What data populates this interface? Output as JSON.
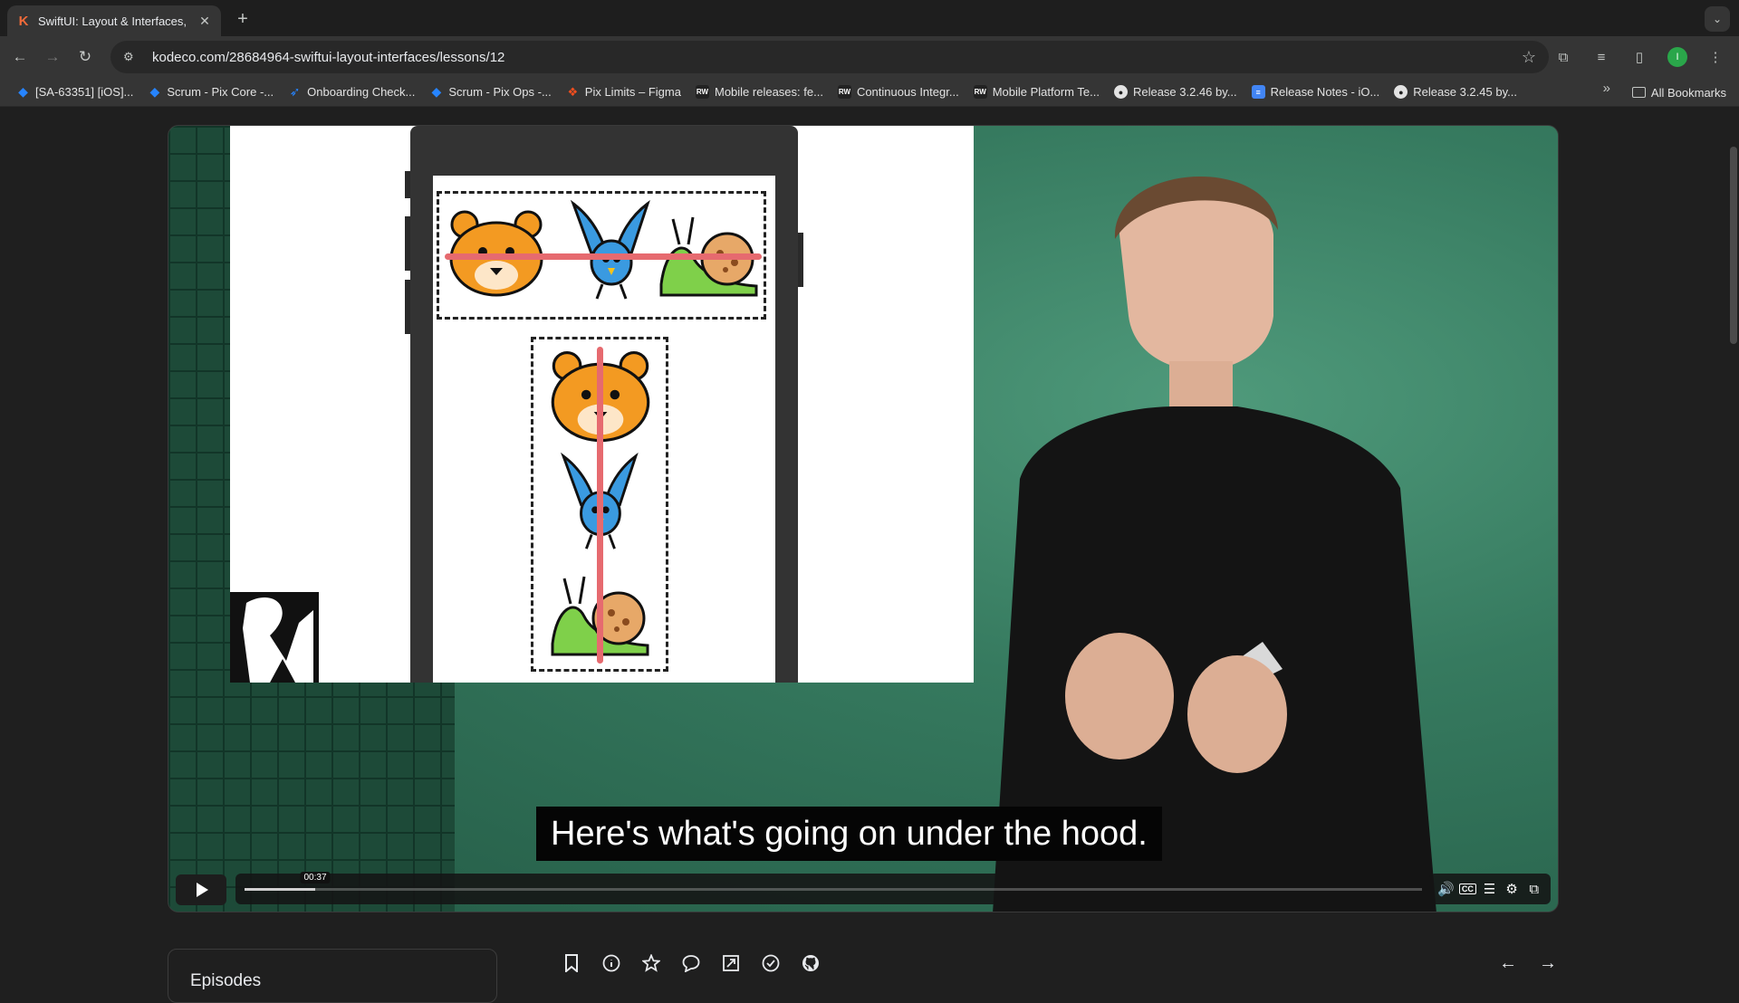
{
  "browser": {
    "tab": {
      "title": "SwiftUI: Layout & Interfaces, l",
      "favicon": "K"
    },
    "url": "kodeco.com/28684964-swiftui-layout-interfaces/lessons/12",
    "profile_initial": "I",
    "bookmarks": [
      {
        "label": "[SA-63351] [iOS]...",
        "icon": "jira-icon"
      },
      {
        "label": "Scrum - Pix Core -...",
        "icon": "jira-icon"
      },
      {
        "label": "Onboarding Check...",
        "icon": "jira-icon"
      },
      {
        "label": "Scrum - Pix Ops -...",
        "icon": "jira-icon"
      },
      {
        "label": "Pix Limits – Figma",
        "icon": "figma-icon"
      },
      {
        "label": "Mobile releases: fe...",
        "icon": "rw-icon"
      },
      {
        "label": "Continuous Integr...",
        "icon": "rw-icon"
      },
      {
        "label": "Mobile Platform Te...",
        "icon": "rw-icon"
      },
      {
        "label": "Release 3.2.46 by...",
        "icon": "github-icon"
      },
      {
        "label": "Release Notes - iO...",
        "icon": "docs-icon"
      },
      {
        "label": "Release 3.2.45 by...",
        "icon": "github-icon"
      }
    ],
    "all_bookmarks": "All Bookmarks"
  },
  "video": {
    "caption": "Here's what's going on under the hood.",
    "current_time": "00:37",
    "progress": 0.06
  },
  "sidebar": {
    "episodes_label": "Episodes"
  },
  "colors": {
    "accent": "#f26b3a",
    "studio_green": "#367a5f",
    "guide_red": "#e66a6f"
  }
}
